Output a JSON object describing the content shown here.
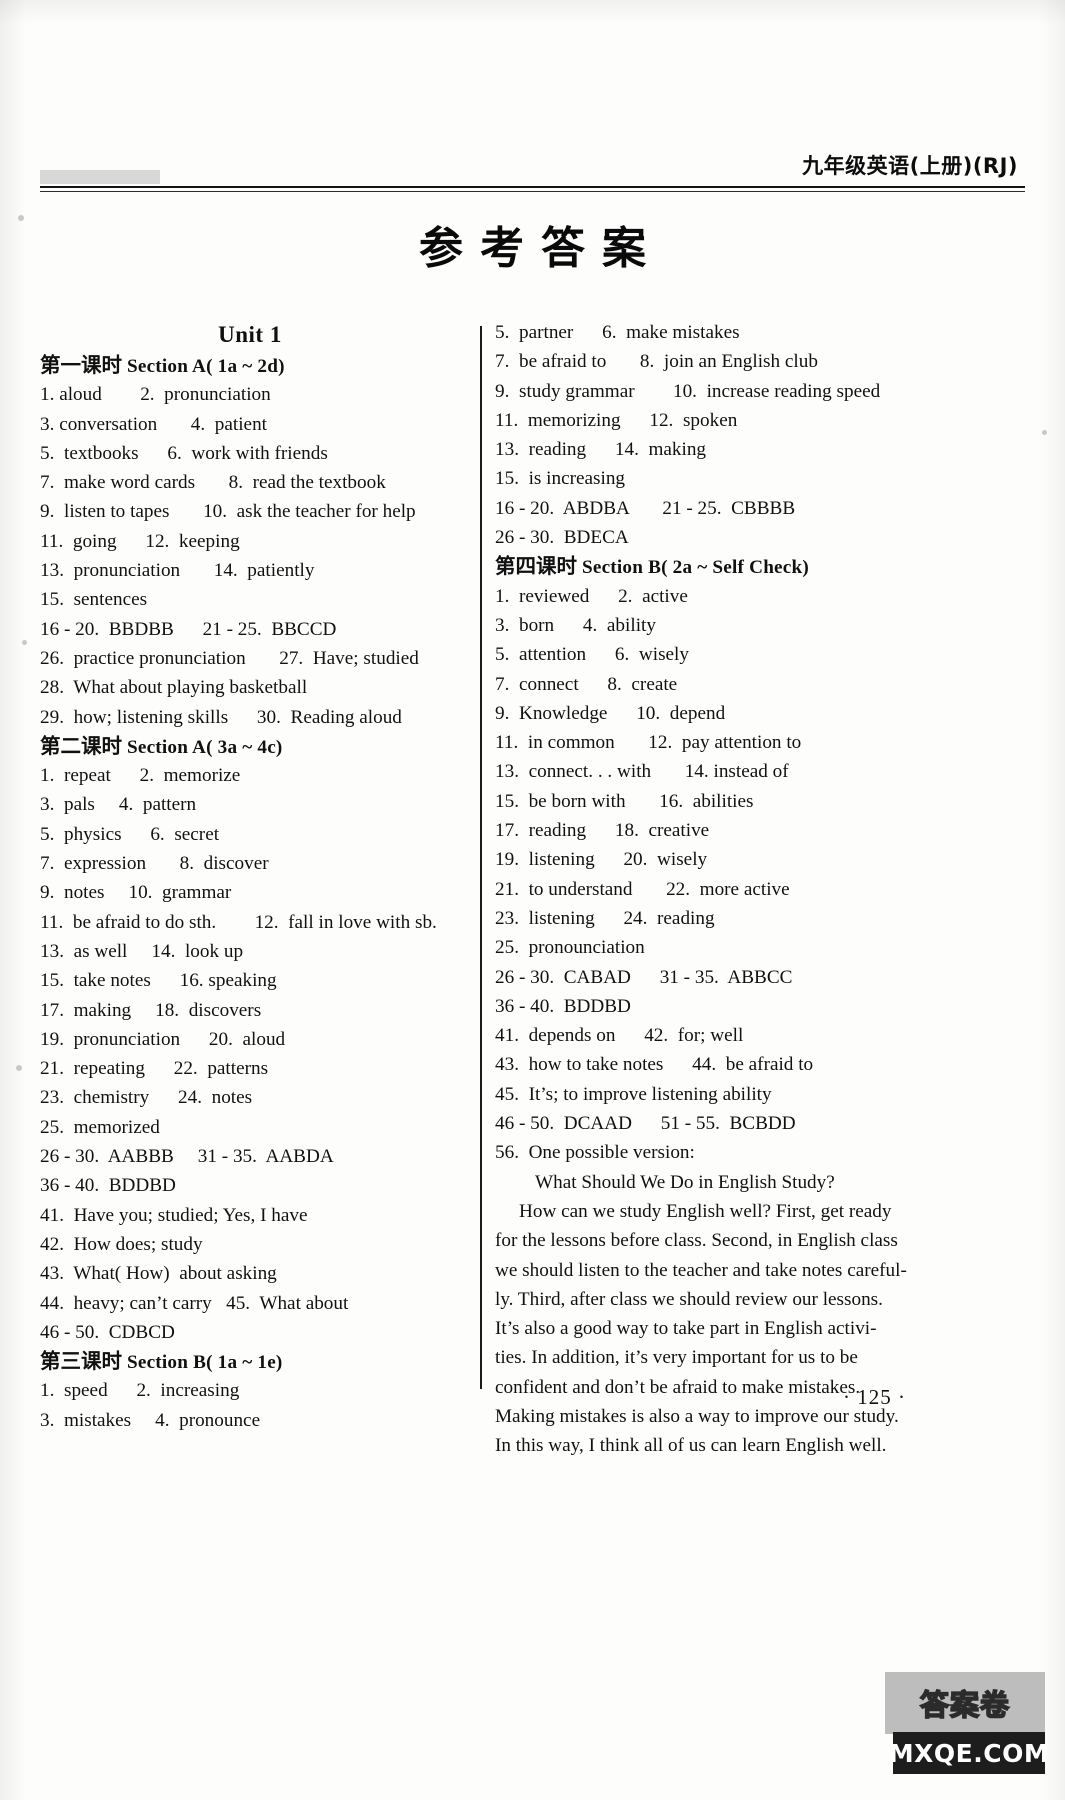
{
  "header": {
    "running_head": "九年级英语(上册)(RJ)",
    "doc_title": "参考答案"
  },
  "unit": {
    "title": "Unit 1"
  },
  "left_column": [
    {
      "type": "unit",
      "text": "Unit 1"
    },
    {
      "type": "section",
      "cn": "第一课时",
      "en": " Section A( 1a ~ 2d)"
    },
    {
      "type": "answer",
      "text": "1. aloud        2.  pronunciation"
    },
    {
      "type": "answer",
      "text": "3. conversation       4.  patient"
    },
    {
      "type": "answer",
      "text": "5.  textbooks      6.  work with friends"
    },
    {
      "type": "answer",
      "text": "7.  make word cards       8.  read the textbook"
    },
    {
      "type": "answer",
      "text": "9.  listen to tapes       10.  ask the teacher for help"
    },
    {
      "type": "answer",
      "text": "11.  going      12.  keeping"
    },
    {
      "type": "answer",
      "text": "13.  pronunciation       14.  patiently"
    },
    {
      "type": "answer",
      "text": "15.  sentences"
    },
    {
      "type": "answer",
      "text": "16 - 20.  BBDBB      21 - 25.  BBCCD"
    },
    {
      "type": "answer",
      "text": "26.  practice pronunciation       27.  Have; studied"
    },
    {
      "type": "answer",
      "text": "28.  What about playing basketball"
    },
    {
      "type": "answer",
      "text": "29.  how; listening skills      30.  Reading aloud"
    },
    {
      "type": "section",
      "cn": "第二课时",
      "en": " Section A( 3a ~ 4c)"
    },
    {
      "type": "answer",
      "text": "1.  repeat      2.  memorize"
    },
    {
      "type": "answer",
      "text": "3.  pals     4.  pattern"
    },
    {
      "type": "answer",
      "text": "5.  physics      6.  secret"
    },
    {
      "type": "answer",
      "text": "7.  expression       8.  discover"
    },
    {
      "type": "answer",
      "text": "9.  notes     10.  grammar"
    },
    {
      "type": "answer",
      "text": "11.  be afraid to do sth.        12.  fall in love with sb."
    },
    {
      "type": "answer",
      "text": "13.  as well     14.  look up"
    },
    {
      "type": "answer",
      "text": "15.  take notes      16. speaking"
    },
    {
      "type": "answer",
      "text": "17.  making     18.  discovers"
    },
    {
      "type": "answer",
      "text": "19.  pronunciation      20.  aloud"
    },
    {
      "type": "answer",
      "text": "21.  repeating      22.  patterns"
    },
    {
      "type": "answer",
      "text": "23.  chemistry      24.  notes"
    },
    {
      "type": "answer",
      "text": "25.  memorized"
    },
    {
      "type": "answer",
      "text": "26 - 30.  AABBB     31 - 35.  AABDA"
    },
    {
      "type": "answer",
      "text": "36 - 40.  BDDBD"
    },
    {
      "type": "answer",
      "text": "41.  Have you; studied; Yes, I have"
    },
    {
      "type": "answer",
      "text": "42.  How does; study"
    },
    {
      "type": "answer",
      "text": "43.  What( How)  about asking"
    },
    {
      "type": "answer",
      "text": "44.  heavy; can’t carry   45.  What about"
    },
    {
      "type": "answer",
      "text": "46 - 50.  CDBCD"
    },
    {
      "type": "section",
      "cn": "第三课时",
      "en": " Section B( 1a ~ 1e)"
    },
    {
      "type": "answer",
      "text": "1.  speed      2.  increasing"
    },
    {
      "type": "answer",
      "text": "3.  mistakes     4.  pronounce"
    }
  ],
  "right_column": [
    {
      "type": "answer",
      "text": "5.  partner      6.  make mistakes"
    },
    {
      "type": "answer",
      "text": "7.  be afraid to       8.  join an English club"
    },
    {
      "type": "answer",
      "text": "9.  study grammar        10.  increase reading speed"
    },
    {
      "type": "answer",
      "text": "11.  memorizing      12.  spoken"
    },
    {
      "type": "answer",
      "text": "13.  reading      14.  making"
    },
    {
      "type": "answer",
      "text": "15.  is increasing"
    },
    {
      "type": "answer",
      "text": "16 - 20.  ABDBA       21 - 25.  CBBBB"
    },
    {
      "type": "answer",
      "text": "26 - 30.  BDECA"
    },
    {
      "type": "section",
      "cn": "第四课时",
      "en": " Section B( 2a ~ Self Check)"
    },
    {
      "type": "answer",
      "text": "1.  reviewed      2.  active"
    },
    {
      "type": "answer",
      "text": "3.  born      4.  ability"
    },
    {
      "type": "answer",
      "text": "5.  attention      6.  wisely"
    },
    {
      "type": "answer",
      "text": "7.  connect      8.  create"
    },
    {
      "type": "answer",
      "text": "9.  Knowledge      10.  depend"
    },
    {
      "type": "answer",
      "text": "11.  in common       12.  pay attention to"
    },
    {
      "type": "answer",
      "text": "13.  connect. . . with       14. instead of"
    },
    {
      "type": "answer",
      "text": "15.  be born with       16.  abilities"
    },
    {
      "type": "answer",
      "text": "17.  reading      18.  creative"
    },
    {
      "type": "answer",
      "text": "19.  listening      20.  wisely"
    },
    {
      "type": "answer",
      "text": "21.  to understand       22.  more active"
    },
    {
      "type": "answer",
      "text": "23.  listening      24.  reading"
    },
    {
      "type": "answer",
      "text": "25.  pronounciation"
    },
    {
      "type": "answer",
      "text": "26 - 30.  CABAD      31 - 35.  ABBCC"
    },
    {
      "type": "answer",
      "text": "36 - 40.  BDDBD"
    },
    {
      "type": "answer",
      "text": "41.  depends on      42.  for; well"
    },
    {
      "type": "answer",
      "text": "43.  how to take notes      44.  be afraid to"
    },
    {
      "type": "answer",
      "text": "45.  It’s; to improve listening ability"
    },
    {
      "type": "answer",
      "text": "46 - 50.  DCAAD      51 - 55.  BCBDD"
    },
    {
      "type": "answer",
      "text": "56.  One possible version:"
    },
    {
      "type": "essay_title",
      "text": "What Should We Do in English Study?"
    },
    {
      "type": "essay_first",
      "text": "How can we study English well? First, get ready"
    },
    {
      "type": "essay",
      "text": "for the lessons before class. Second, in English class"
    },
    {
      "type": "essay",
      "text": "we should listen to the teacher and take notes careful-"
    },
    {
      "type": "essay",
      "text": "ly. Third, after class we should review our lessons."
    },
    {
      "type": "essay",
      "text": "It’s also a good way to take part in English activi-"
    },
    {
      "type": "essay",
      "text": "ties. In addition, it’s very important for us to be"
    },
    {
      "type": "essay",
      "text": "confident and don’t be afraid to make mistakes."
    },
    {
      "type": "essay",
      "text": "Making mistakes is also a way to improve our study."
    },
    {
      "type": "essay",
      "text": "In this way, I think all of us can learn English well."
    }
  ],
  "footer": {
    "page_number": "· 125 ·"
  },
  "watermark": {
    "label_cn": "答案卷",
    "url": "MXQE.COM"
  }
}
